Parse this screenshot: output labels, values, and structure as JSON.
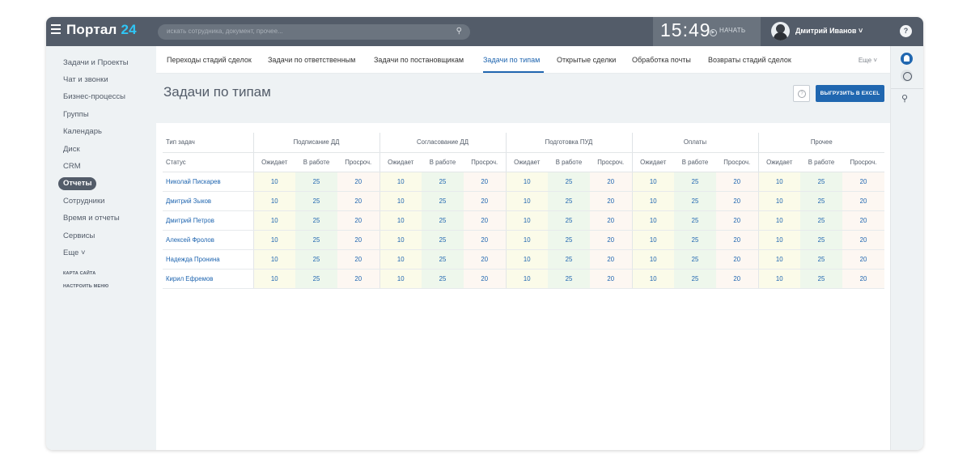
{
  "app": {
    "logo_name": "Портал",
    "logo_num": "24"
  },
  "search": {
    "placeholder": "искать сотрудника, документ, прочее..."
  },
  "clock": {
    "time": "15:49",
    "start_label": "НАЧАТЬ"
  },
  "user": {
    "name": "Дмитрий Иванов"
  },
  "sidebar": {
    "items": [
      "Задачи и Проекты",
      "Чат и звонки",
      "Бизнес-процессы",
      "Группы",
      "Календарь",
      "Диск",
      "CRM",
      "Отчеты",
      "Сотрудники",
      "Время и отчеты",
      "Сервисы",
      "Еще"
    ],
    "active": "Отчеты",
    "site_map": "КАРТА САЙТА",
    "configure_menu": "НАСТРОИТЬ МЕНЮ"
  },
  "tabs": {
    "items": [
      "Переходы стадий сделок",
      "Задачи по ответственным",
      "Задачи по постановщикам",
      "Задачи по типам",
      "Открытые сделки",
      "Обработка почты",
      "Возвраты стадий сделок"
    ],
    "active_index": 3,
    "more": "Еще"
  },
  "page": {
    "title": "Задачи по типам",
    "export_label": "ВЫГРУЗИТЬ В EXCEL"
  },
  "table": {
    "type_header": "Тип задач",
    "status_header": "Статус",
    "groups": [
      "Подписание ДД",
      "Согласование ДД",
      "Подготовка ПУД",
      "Оплаты",
      "Прочее"
    ],
    "statuses": [
      "Ожидает",
      "В работе",
      "Просроч."
    ],
    "rows": [
      {
        "name": "Николай Пискарев",
        "values": [
          "10",
          "25",
          "20",
          "10",
          "25",
          "20",
          "10",
          "25",
          "20",
          "10",
          "25",
          "20",
          "10",
          "25",
          "20"
        ]
      },
      {
        "name": "Дмитрий Зыков",
        "values": [
          "10",
          "25",
          "20",
          "10",
          "25",
          "20",
          "10",
          "25",
          "20",
          "10",
          "25",
          "20",
          "10",
          "25",
          "20"
        ]
      },
      {
        "name": "Дмитрий Петров",
        "values": [
          "10",
          "25",
          "20",
          "10",
          "25",
          "20",
          "10",
          "25",
          "20",
          "10",
          "25",
          "20",
          "10",
          "25",
          "20"
        ]
      },
      {
        "name": "Алексей Фролов",
        "values": [
          "10",
          "25",
          "20",
          "10",
          "25",
          "20",
          "10",
          "25",
          "20",
          "10",
          "25",
          "20",
          "10",
          "25",
          "20"
        ]
      },
      {
        "name": "Надежда Пронина",
        "values": [
          "10",
          "25",
          "20",
          "10",
          "25",
          "20",
          "10",
          "25",
          "20",
          "10",
          "25",
          "20",
          "10",
          "25",
          "20"
        ]
      },
      {
        "name": "Кирил Ефремов",
        "values": [
          "10",
          "25",
          "20",
          "10",
          "25",
          "20",
          "10",
          "25",
          "20",
          "10",
          "25",
          "20",
          "10",
          "25",
          "20"
        ]
      }
    ]
  },
  "icons": {
    "menu": "hamburger-icon",
    "search": "magnifier-icon",
    "help": "question-icon",
    "notifications": "bell-icon",
    "messenger": "chat-icon"
  },
  "colors": {
    "topbar": "#535c69",
    "accent_blue": "#2067b0",
    "link_blue": "#2066b0",
    "logo_num": "#2fc6f6",
    "cell_wait": "#fbfbe9",
    "cell_work": "#eef7ec",
    "cell_late": "#fdf7f2"
  }
}
